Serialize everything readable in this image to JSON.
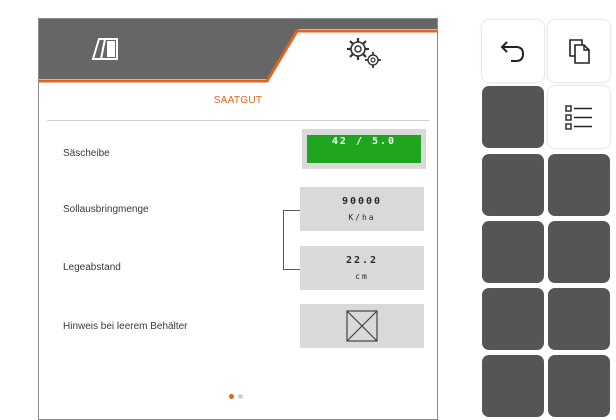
{
  "header": {
    "tab_machine_icon": "machine-icon",
    "tab_settings_icon": "gears-icon",
    "accent_color": "#e0651c",
    "header_bg": "#666666"
  },
  "section": {
    "title": "SAATGUT"
  },
  "rows": {
    "row1": {
      "label": "Säscheibe",
      "value": "42 / 5.0"
    },
    "row2": {
      "label": "Sollausbringmenge",
      "value": "90000",
      "unit": "K/ha"
    },
    "row3": {
      "label": "Legeabstand",
      "value": "22.2",
      "unit": "cm"
    },
    "row4": {
      "label": "Hinweis bei leerem Behälter",
      "checkbox_icon": "checkbox-crossed-icon"
    }
  },
  "pager": {
    "pages": 2,
    "active": 1
  },
  "side_buttons": {
    "back": "back-arrow-icon",
    "copy": "copy-pages-icon",
    "list": "list-icon",
    "blank_dark_count": 8
  },
  "colors": {
    "green_value": "#1fa51f",
    "dark_button": "#555555",
    "value_box": "#d9d9d9"
  }
}
